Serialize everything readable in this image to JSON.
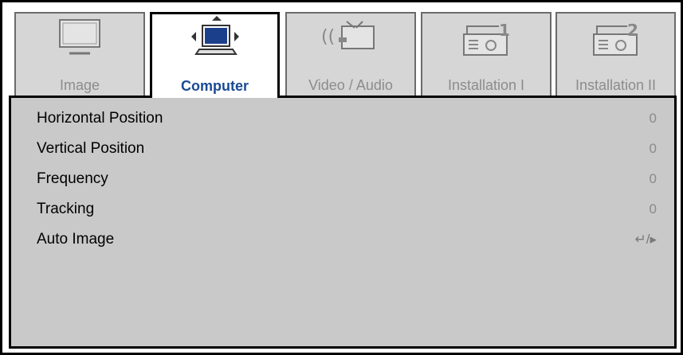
{
  "tabs": [
    {
      "label": "Image",
      "icon": "monitor-icon",
      "active": false
    },
    {
      "label": "Computer",
      "icon": "laptop-icon",
      "active": true
    },
    {
      "label": "Video / Audio",
      "icon": "video-audio-icon",
      "active": false
    },
    {
      "label": "Installation I",
      "icon": "projector-1-icon",
      "active": false
    },
    {
      "label": "Installation II",
      "icon": "projector-2-icon",
      "active": false
    }
  ],
  "menu": [
    {
      "label": "Horizontal Position",
      "value": "0"
    },
    {
      "label": "Vertical Position",
      "value": "0"
    },
    {
      "label": "Frequency",
      "value": "0"
    },
    {
      "label": "Tracking",
      "value": "0"
    },
    {
      "label": "Auto Image",
      "value": "↵/▸"
    }
  ],
  "colors": {
    "active_label": "#1a4a94",
    "inactive_label": "#8c8c8c",
    "panel_bg": "#c9c9c9",
    "tab_bg": "#d6d6d6"
  }
}
